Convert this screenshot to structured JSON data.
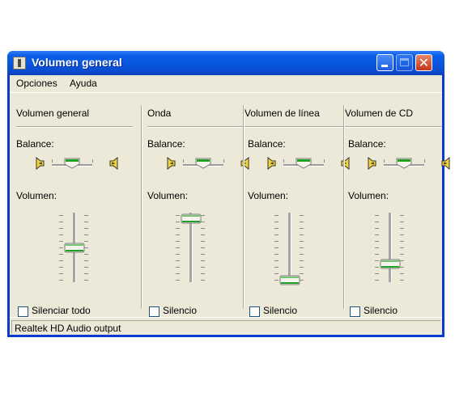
{
  "window": {
    "title": "Volumen general",
    "close_glyph": "✕",
    "accent": "#0a5ee8"
  },
  "menu": [
    "Opciones",
    "Ayuda"
  ],
  "labels": {
    "balance": "Balance:",
    "volume": "Volumen:"
  },
  "icons": {
    "speaker": "speaker-icon",
    "app": "volume-control-icon"
  },
  "columns": [
    {
      "title": "Volumen general",
      "mute_label": "Silenciar todo",
      "muted": false,
      "balance": 0.5,
      "volume": 0.5
    },
    {
      "title": "Onda",
      "mute_label": "Silencio",
      "muted": false,
      "balance": 0.5,
      "volume": 0.95
    },
    {
      "title": "Volumen de línea",
      "mute_label": "Silencio",
      "muted": false,
      "balance": 0.5,
      "volume": 0.0
    },
    {
      "title": "Volumen de CD",
      "mute_label": "Silencio",
      "muted": false,
      "balance": 0.5,
      "volume": 0.25
    }
  ],
  "status": {
    "text": "Realtek HD Audio output"
  }
}
